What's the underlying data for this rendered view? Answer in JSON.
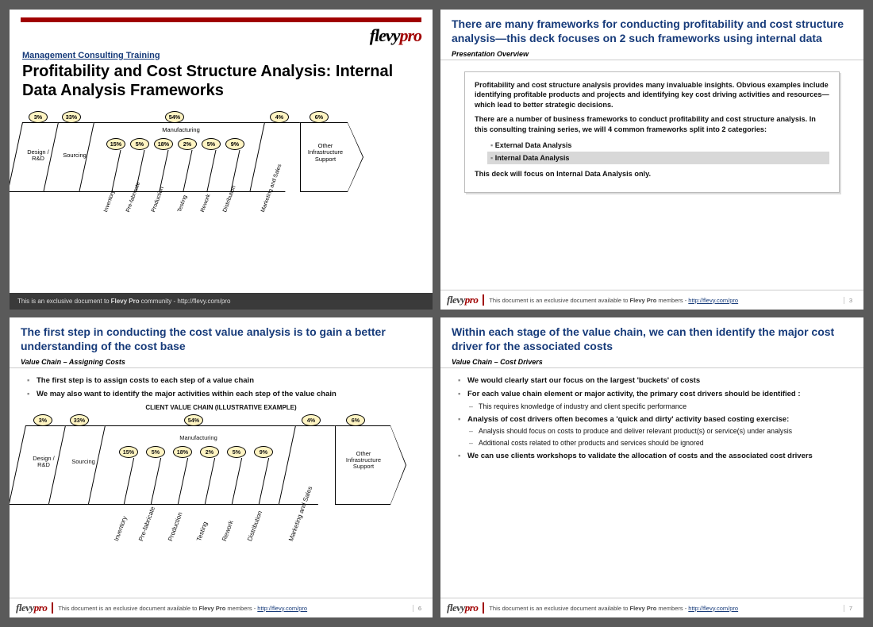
{
  "brand": {
    "name": "flevy",
    "suffix": "pro"
  },
  "slide1": {
    "kicker": "Management Consulting Training",
    "title": "Profitability and Cost Structure Analysis: Internal Data Analysis Frameworks",
    "footer_prefix": "This is an exclusive document to ",
    "footer_bold": "Flevy Pro",
    "footer_suffix": " community - http://flevy.com/pro"
  },
  "slide2": {
    "headline": "There are many frameworks for conducting profitability and cost structure analysis—this deck focuses on 2 such frameworks using internal data",
    "subhead": "Presentation Overview",
    "para1": "Profitability and cost structure analysis provides many invaluable insights. Obvious examples include identifying profitable products and projects and identifying key cost driving activities and resources—which lead to better strategic decisions.",
    "para2": "There are a number of business frameworks to conduct profitability and cost structure analysis.  In this consulting training series, we will 4 common frameworks split into 2 categories:",
    "cat1": "External Data Analysis",
    "cat2": "Internal Data Analysis",
    "closing": "This deck will focus on Internal Data Analysis only.",
    "page": "3"
  },
  "slide3": {
    "headline": "The first step in conducting the cost value analysis is to gain a better understanding of the cost base",
    "subhead": "Value Chain – Assigning Costs",
    "b1": "The first step is to assign costs to each step of a value chain",
    "b2": "We may also want to identify the major activities within each step of the value chain",
    "vc_title": "CLIENT VALUE CHAIN (ILLUSTRATIVE EXAMPLE)",
    "page": "6"
  },
  "slide4": {
    "headline": "Within each stage of the value chain, we can then identify the major cost driver for the associated costs",
    "subhead": "Value Chain – Cost Drivers",
    "b1": "We would clearly start our focus on the largest 'buckets' of costs",
    "b2": "For each value chain element or major activity, the primary cost drivers should be identified :",
    "b2a": "This requires knowledge of industry and client specific performance",
    "b3": "Analysis of cost drivers often becomes a 'quick and dirty' activity based costing exercise:",
    "b3a": "Analysis should focus on costs to produce and deliver relevant product(s) or service(s) under analysis",
    "b3b": "Additional costs related to other products and services should be ignored",
    "b4": "We can use clients workshops to validate the allocation of costs and the associated cost drivers",
    "page": "7"
  },
  "footer_doc": {
    "prefix": "This document is an exclusive document available to ",
    "bold": "Flevy Pro",
    "mid": " members - ",
    "url": "http://flevy.com/pro"
  },
  "chart_data": {
    "type": "bar",
    "title": "Client Value Chain cost allocation (illustrative)",
    "stages": [
      {
        "name": "Design / R&D",
        "pct": 3
      },
      {
        "name": "Sourcing",
        "pct": 33
      },
      {
        "name": "Manufacturing",
        "pct": 54,
        "sub": [
          {
            "name": "Inventory",
            "pct": 15
          },
          {
            "name": "Pre-fabricate",
            "pct": 5
          },
          {
            "name": "Production",
            "pct": 18
          },
          {
            "name": "Testing",
            "pct": 2
          },
          {
            "name": "Rework",
            "pct": 5
          },
          {
            "name": "Distribution",
            "pct": 9
          }
        ]
      },
      {
        "name": "Marketing and Sales",
        "pct": 4
      },
      {
        "name": "Other Infrastructure Support",
        "pct": 6
      }
    ],
    "xlabel": "",
    "ylabel": "",
    "ylim": [
      0,
      100
    ]
  },
  "vc_labels": {
    "s0": "Design / R&D",
    "s1": "Sourcing",
    "s2": "Manufacturing",
    "s3": "Marketing and Sales",
    "s4": "Other Infrastructure Support",
    "sub0": "Inventory",
    "sub1": "Pre-fabricate",
    "sub2": "Production",
    "sub3": "Testing",
    "sub4": "Rework",
    "sub5": "Distribution",
    "p0": "3%",
    "p1": "33%",
    "p2": "54%",
    "p3": "4%",
    "p4": "6%",
    "sp0": "15%",
    "sp1": "5%",
    "sp2": "18%",
    "sp3": "2%",
    "sp4": "5%",
    "sp5": "9%"
  }
}
